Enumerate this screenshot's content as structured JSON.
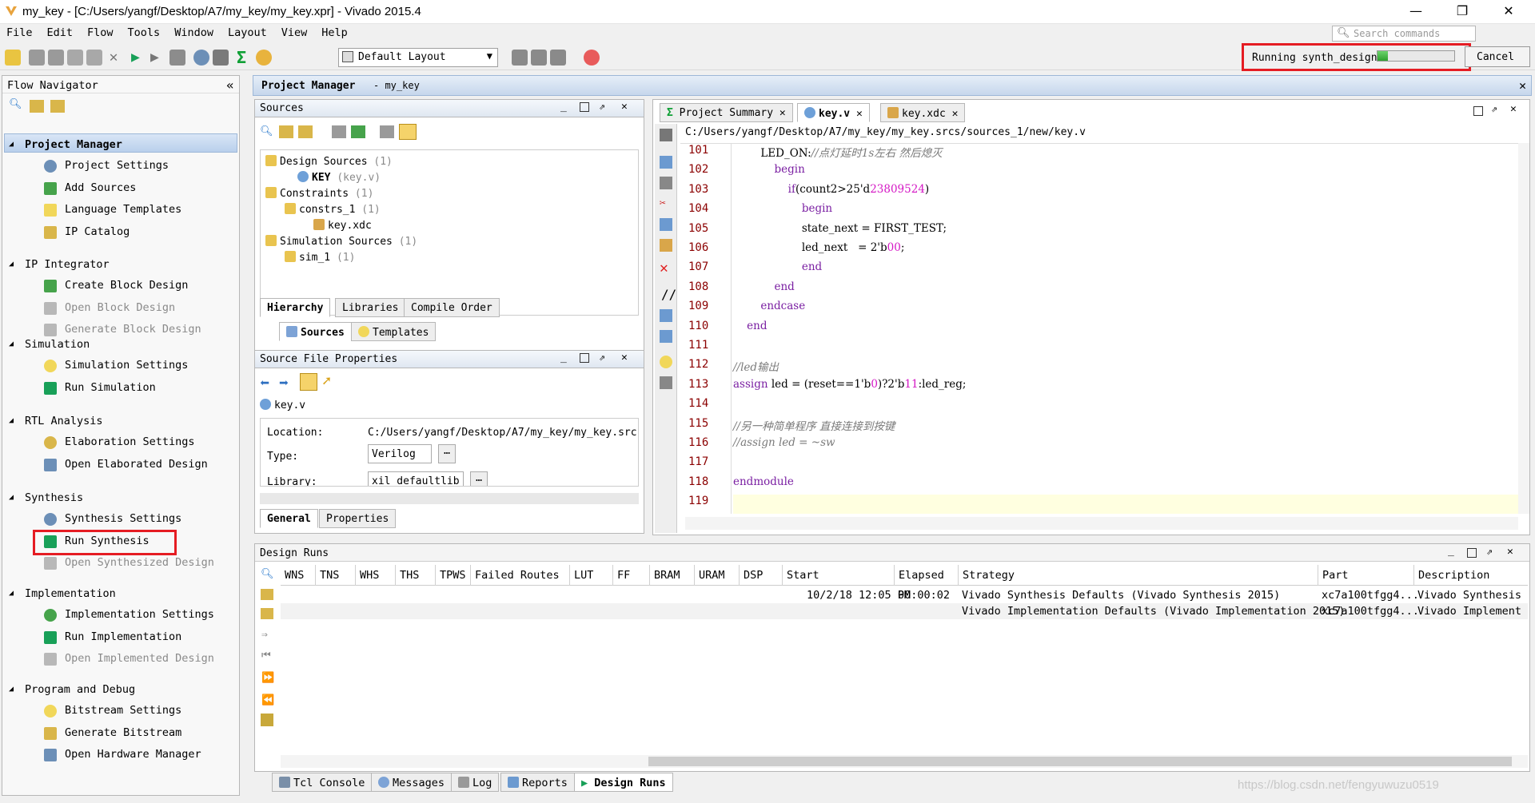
{
  "window": {
    "title": "my_key - [C:/Users/yangf/Desktop/A7/my_key/my_key.xpr] - Vivado 2015.4"
  },
  "menu": [
    "File",
    "Edit",
    "Flow",
    "Tools",
    "Window",
    "Layout",
    "View",
    "Help"
  ],
  "search": {
    "placeholder": "Search commands"
  },
  "toolbar": {
    "layout": "Default Layout"
  },
  "status": {
    "running": "Running synth_design",
    "progress": 0.14,
    "cancel": "Cancel"
  },
  "flow_nav": {
    "title": "Flow Navigator",
    "sections": [
      {
        "label": "Project Manager",
        "items": [
          "Project Settings",
          "Add Sources",
          "Language Templates",
          "IP Catalog"
        ]
      },
      {
        "label": "IP Integrator",
        "items": [
          "Create Block Design",
          "Open Block Design",
          "Generate Block Design"
        ]
      },
      {
        "label": "Simulation",
        "items": [
          "Simulation Settings",
          "Run Simulation"
        ]
      },
      {
        "label": "RTL Analysis",
        "items": [
          "Elaboration Settings",
          "Open Elaborated Design"
        ]
      },
      {
        "label": "Synthesis",
        "items": [
          "Synthesis Settings",
          "Run Synthesis",
          "Open Synthesized Design"
        ]
      },
      {
        "label": "Implementation",
        "items": [
          "Implementation Settings",
          "Run Implementation",
          "Open Implemented Design"
        ]
      },
      {
        "label": "Program and Debug",
        "items": [
          "Bitstream Settings",
          "Generate Bitstream",
          "Open Hardware Manager"
        ]
      }
    ]
  },
  "pm_header": {
    "title": "Project Manager",
    "project": "- my_key"
  },
  "sources": {
    "title": "Sources",
    "tree": [
      {
        "label": "Design Sources",
        "count": "(1)"
      },
      {
        "label": "KEY",
        "count": "(key.v)"
      },
      {
        "label": "Constraints",
        "count": "(1)"
      },
      {
        "label": "constrs_1",
        "count": "(1)"
      },
      {
        "label": "key.xdc",
        "count": ""
      },
      {
        "label": "Simulation Sources",
        "count": "(1)"
      },
      {
        "label": "sim_1",
        "count": "(1)"
      }
    ],
    "tabs": [
      "Hierarchy",
      "Libraries",
      "Compile Order"
    ],
    "subtabs": [
      "Sources",
      "Templates"
    ]
  },
  "sfp": {
    "title": "Source File Properties",
    "file": "key.v",
    "location_label": "Location:",
    "location": "C:/Users/yangf/Desktop/A7/my_key/my_key.src",
    "type_label": "Type:",
    "type": "Verilog",
    "library_label": "Library:",
    "library": "xil_defaultlib",
    "tabs": [
      "General",
      "Properties"
    ]
  },
  "editor": {
    "tabs": [
      "Project Summary",
      "key.v",
      "key.xdc"
    ],
    "path": "C:/Users/yangf/Desktop/A7/my_key/my_key.srcs/sources_1/new/key.v",
    "lines": [
      {
        "n": "101",
        "code": "        LED_ON://点灯延时1s左右 然后熄灭"
      },
      {
        "n": "102",
        "code": "            begin"
      },
      {
        "n": "103",
        "code": "                if(count2>25'd23809524)"
      },
      {
        "n": "104",
        "code": "                    begin"
      },
      {
        "n": "105",
        "code": "                    state_next = FIRST_TEST;"
      },
      {
        "n": "106",
        "code": "                    led_next   = 2'b00;"
      },
      {
        "n": "107",
        "code": "                    end"
      },
      {
        "n": "108",
        "code": "            end"
      },
      {
        "n": "109",
        "code": "        endcase"
      },
      {
        "n": "110",
        "code": "    end"
      },
      {
        "n": "111",
        "code": ""
      },
      {
        "n": "112",
        "code": "//led输出"
      },
      {
        "n": "113",
        "code": "assign led = (reset==1'b0)?2'b11:led_reg;"
      },
      {
        "n": "114",
        "code": ""
      },
      {
        "n": "115",
        "code": "//另一种简单程序 直接连接到按键"
      },
      {
        "n": "116",
        "code": "//assign led = ~sw"
      },
      {
        "n": "117",
        "code": ""
      },
      {
        "n": "118",
        "code": "endmodule"
      },
      {
        "n": "119",
        "code": ""
      }
    ]
  },
  "runs": {
    "title": "Design Runs",
    "columns": [
      "WNS",
      "TNS",
      "WHS",
      "THS",
      "TPWS",
      "Failed Routes",
      "LUT",
      "FF",
      "BRAM",
      "URAM",
      "DSP",
      "Start",
      "Elapsed",
      "Strategy",
      "Part",
      "Description"
    ],
    "rows": [
      {
        "start": "10/2/18 12:05 PM",
        "elapsed": "00:00:02",
        "strategy": "Vivado Synthesis Defaults (Vivado Synthesis 2015)",
        "part": "xc7a100tfgg4...",
        "description": "Vivado Synthesis"
      },
      {
        "start": "",
        "elapsed": "",
        "strategy": "Vivado Implementation Defaults (Vivado Implementation 2015)",
        "part": "xc7a100tfgg4...",
        "description": "Vivado Implement"
      }
    ]
  },
  "bottom_tabs": [
    "Tcl Console",
    "Messages",
    "Log",
    "Reports",
    "Design Runs"
  ],
  "watermark": "https://blog.csdn.net/fengyuwuzu0519",
  "colors": {
    "highlight_red": "#e51c23",
    "line_number": "#8b0000",
    "keyword": "#7a1fa2",
    "number": "#d417c4",
    "current_line": "#ffffe0"
  }
}
